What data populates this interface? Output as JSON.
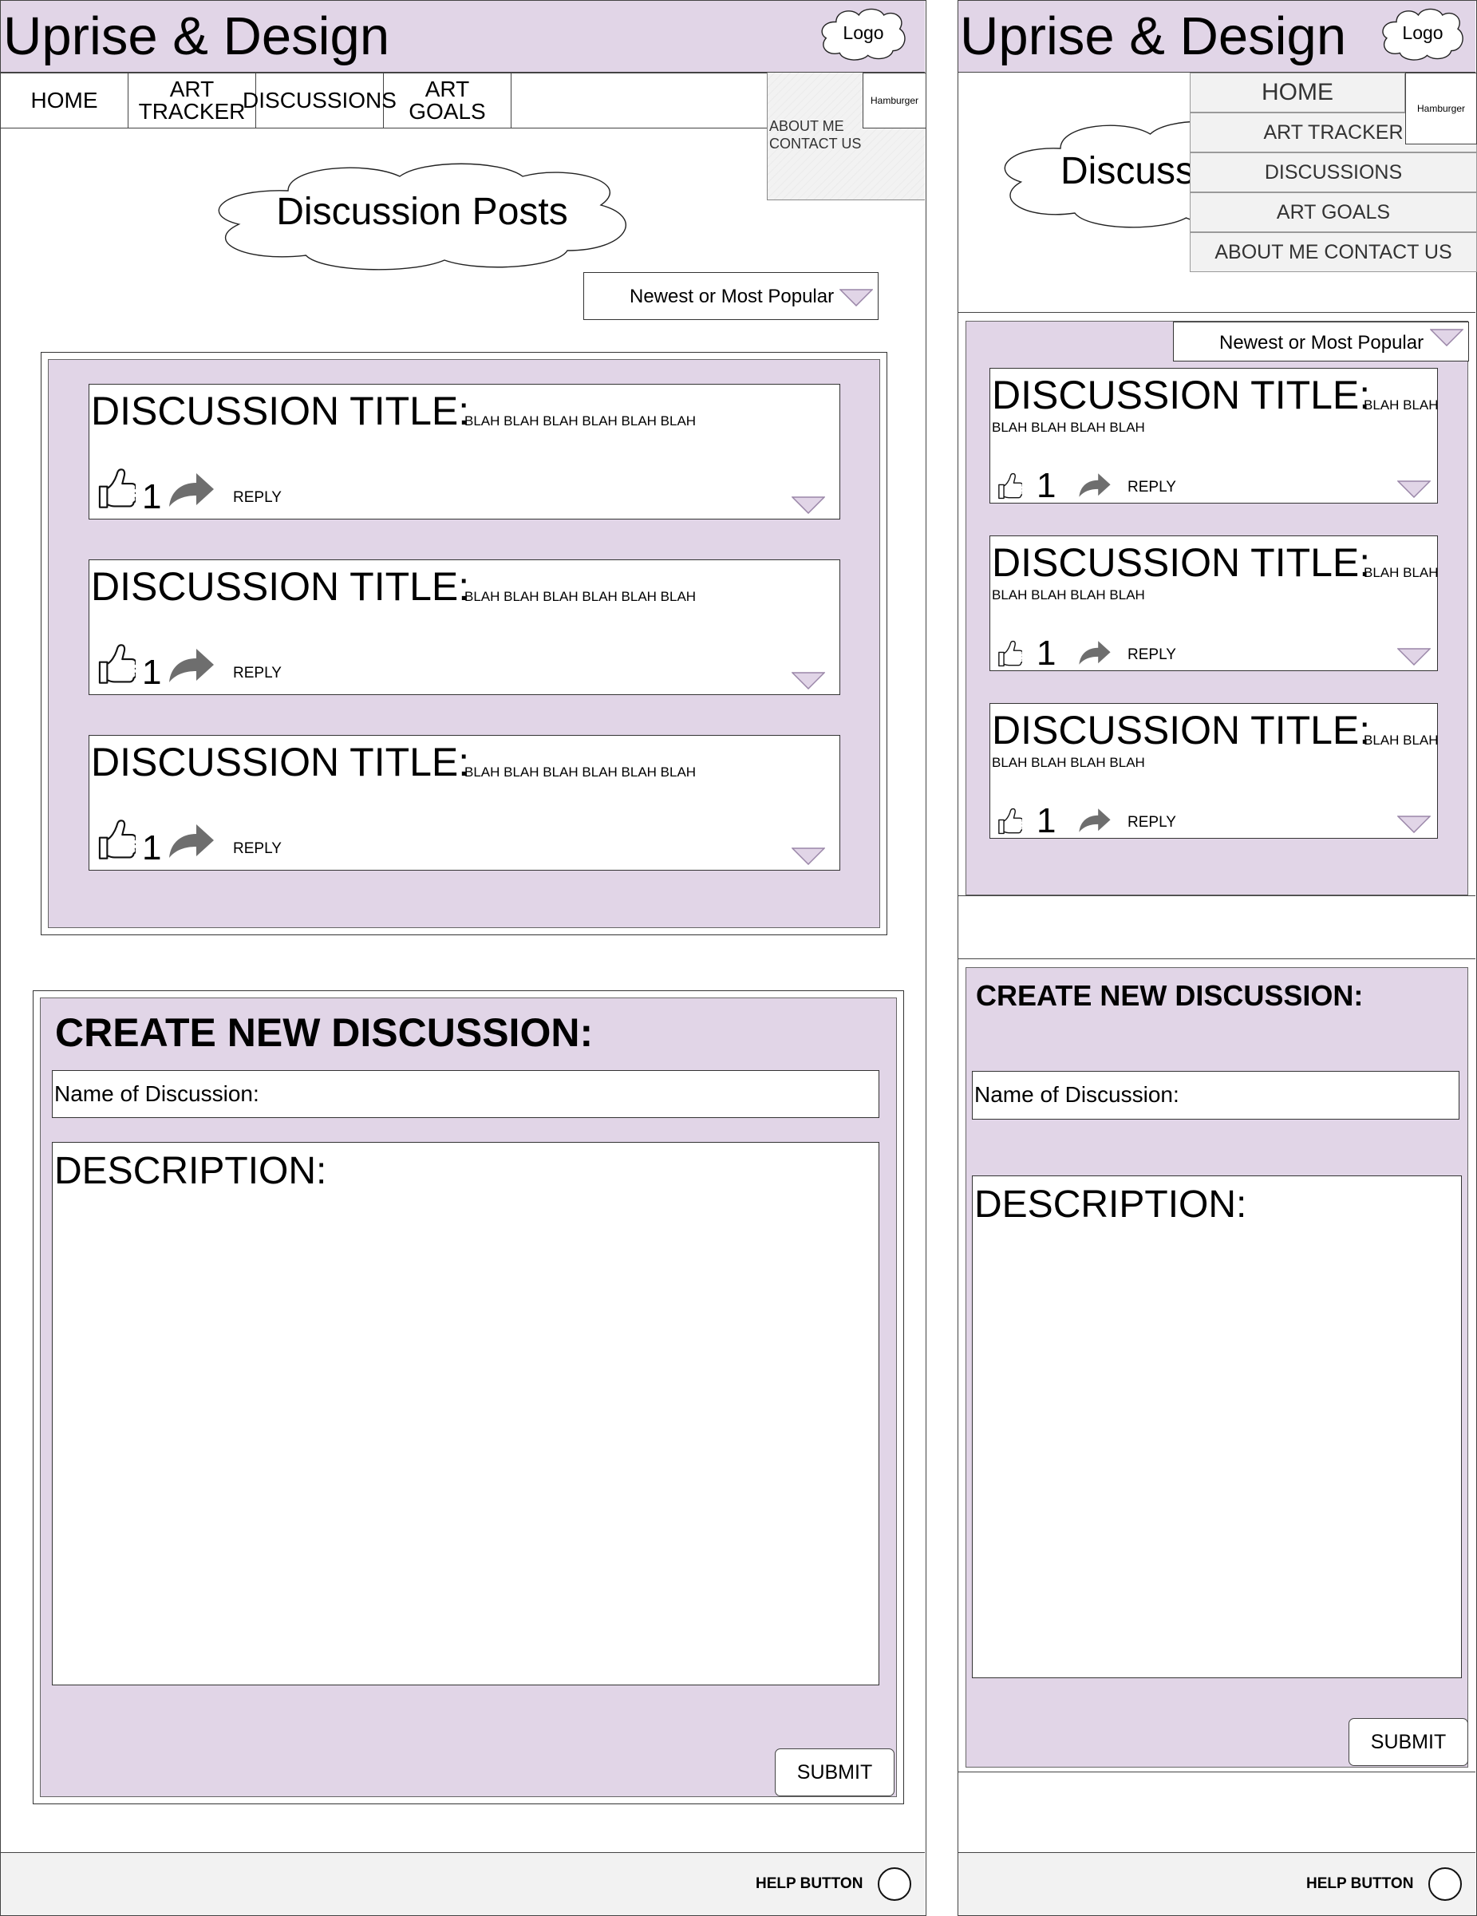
{
  "app": {
    "title": "Uprise & Design",
    "logo_label": "Logo",
    "hamburger_label": "Hamburger"
  },
  "nav": {
    "items": [
      "HOME",
      "ART TRACKER",
      "DISCUSSIONS",
      "ART GOALS"
    ],
    "overflow_items": [
      "ABOUT ME",
      "CONTACT US"
    ]
  },
  "mobile_menu": {
    "items": [
      "HOME",
      "ART TRACKER",
      "DISCUSSIONS",
      "ART GOALS",
      "ABOUT ME CONTACT US"
    ]
  },
  "page": {
    "heading": "Discussion Posts",
    "heading_mobile_visible": "Discuss"
  },
  "sort": {
    "label": "Newest or Most Popular"
  },
  "discussions": [
    {
      "title": "DISCUSSION TITLE:",
      "body": "BLAH BLAH BLAH BLAH BLAH BLAH",
      "likes": "1",
      "reply_label": "REPLY"
    },
    {
      "title": "DISCUSSION TITLE:",
      "body": "BLAH BLAH BLAH BLAH BLAH BLAH",
      "likes": "1",
      "reply_label": "REPLY"
    },
    {
      "title": "DISCUSSION TITLE:",
      "body": "BLAH BLAH BLAH BLAH BLAH BLAH",
      "likes": "1",
      "reply_label": "REPLY"
    }
  ],
  "mobile_discussions": [
    {
      "title": "DISCUSSION TITLE:",
      "body_line1": "BLAH BLAH",
      "body_line2": "BLAH BLAH BLAH BLAH",
      "likes": "1",
      "reply_label": "REPLY"
    },
    {
      "title": "DISCUSSION TITLE:",
      "body_line1": "BLAH BLAH",
      "body_line2": "BLAH BLAH BLAH BLAH",
      "likes": "1",
      "reply_label": "REPLY"
    },
    {
      "title": "DISCUSSION TITLE:",
      "body_line1": "BLAH BLAH",
      "body_line2": "BLAH BLAH BLAH BLAH",
      "likes": "1",
      "reply_label": "REPLY"
    }
  ],
  "create": {
    "heading": "CREATE NEW DISCUSSION:",
    "name_placeholder": "Name of Discussion:",
    "description_placeholder": "DESCRIPTION:",
    "submit_label": "SUBMIT"
  },
  "footer": {
    "help_label": "HELP BUTTON"
  },
  "colors": {
    "accent": "#e1d5e7",
    "chrome": "#f2f2f2",
    "icon_grey": "#707070"
  }
}
